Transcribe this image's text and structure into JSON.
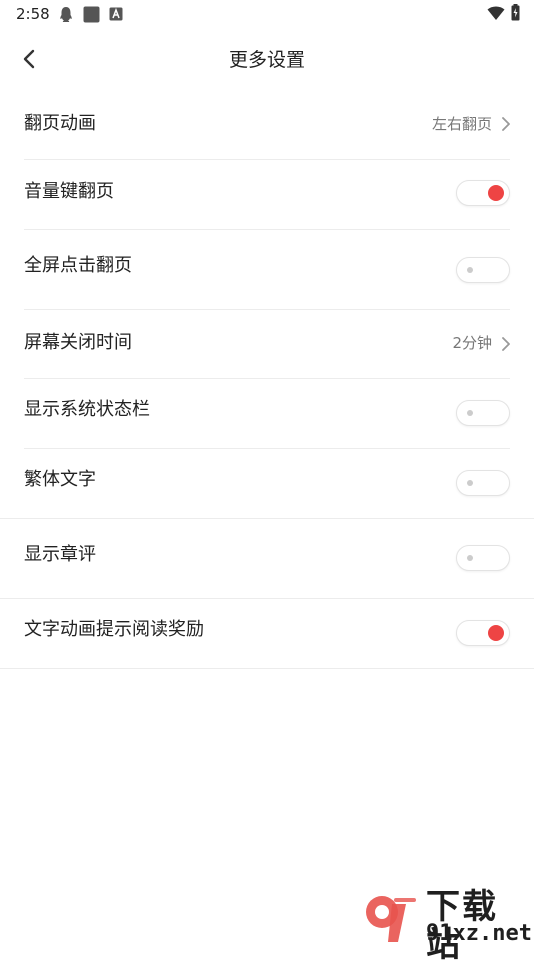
{
  "status_bar": {
    "time": "2:58",
    "icons_left": [
      "qq-icon",
      "app-square-icon",
      "a-box-icon"
    ],
    "icons_right": [
      "wifi-icon",
      "battery-icon"
    ]
  },
  "header": {
    "title": "更多设置",
    "back_icon": "chevron-left-icon"
  },
  "settings": [
    {
      "label": "翻页动画",
      "type": "nav",
      "value": "左右翻页"
    },
    {
      "label": "音量键翻页",
      "type": "toggle",
      "on": true
    },
    {
      "label": "全屏点击翻页",
      "type": "toggle",
      "on": false
    },
    {
      "label": "屏幕关闭时间",
      "type": "nav",
      "value": "2分钟"
    },
    {
      "label": "显示系统状态栏",
      "type": "toggle",
      "on": false
    },
    {
      "label": "繁体文字",
      "type": "toggle",
      "on": false
    },
    {
      "label": "显示章评",
      "type": "toggle",
      "on": false
    },
    {
      "label": "文字动画提示阅读奖励",
      "type": "toggle",
      "on": true
    }
  ],
  "watermark": {
    "brand": "下载站",
    "url": "91xz.net"
  },
  "colors": {
    "accent": "#ee4444",
    "text": "#222222",
    "secondary_text": "#777777",
    "divider": "#ececec"
  }
}
